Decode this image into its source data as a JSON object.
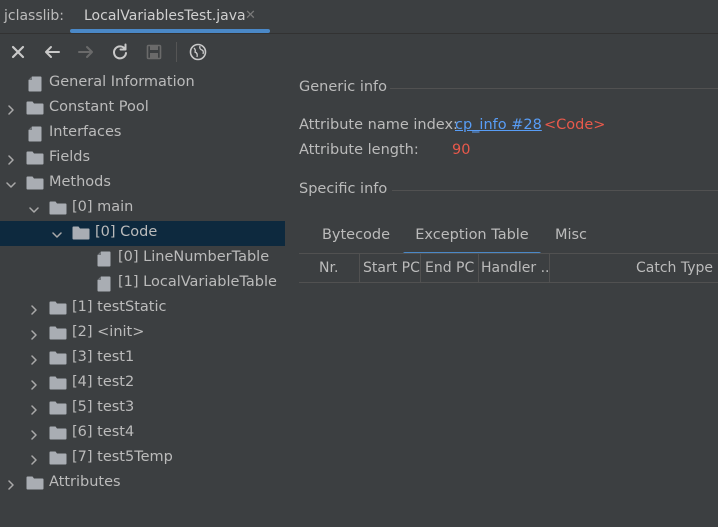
{
  "title_bar": {
    "app_label": "jclasslib:",
    "tab_label": "LocalVariablesTest.java",
    "tab_close": "✕"
  },
  "toolbar": {
    "buttons": [
      "close-icon",
      "back-icon",
      "forward-icon",
      "refresh-icon",
      "save-icon",
      "browser-icon"
    ]
  },
  "tree": {
    "items": [
      {
        "label": "General Information",
        "type": "file",
        "expand": "none"
      },
      {
        "label": "Constant Pool",
        "type": "folder",
        "expand": "collapsed"
      },
      {
        "label": "Interfaces",
        "type": "file",
        "expand": "none"
      },
      {
        "label": "Fields",
        "type": "folder",
        "expand": "collapsed"
      },
      {
        "label": "Methods",
        "type": "folder",
        "expand": "expanded"
      },
      {
        "label": "[0] main",
        "type": "folder",
        "expand": "expanded"
      },
      {
        "label": "[0] Code",
        "type": "folder",
        "expand": "expanded",
        "selected": true
      },
      {
        "label": "[0] LineNumberTable",
        "type": "file",
        "expand": "none"
      },
      {
        "label": "[1] LocalVariableTable",
        "type": "file",
        "expand": "none"
      },
      {
        "label": "[1] testStatic",
        "type": "folder",
        "expand": "collapsed"
      },
      {
        "label": "[2] <init>",
        "type": "folder",
        "expand": "collapsed"
      },
      {
        "label": "[3] test1",
        "type": "folder",
        "expand": "collapsed"
      },
      {
        "label": "[4] test2",
        "type": "folder",
        "expand": "collapsed"
      },
      {
        "label": "[5] test3",
        "type": "folder",
        "expand": "collapsed"
      },
      {
        "label": "[6] test4",
        "type": "folder",
        "expand": "collapsed"
      },
      {
        "label": "[7] test5Temp",
        "type": "folder",
        "expand": "collapsed"
      },
      {
        "label": "Attributes",
        "type": "folder",
        "expand": "collapsed"
      }
    ]
  },
  "generic_info": {
    "title": "Generic info",
    "name_index_label": "Attribute name index:",
    "name_index_link": "cp_info #28",
    "name_index_value": "<Code>",
    "length_label": "Attribute length:",
    "length_value": "90"
  },
  "specific_info": {
    "title": "Specific info",
    "tabs": [
      "Bytecode",
      "Exception Table",
      "Misc"
    ],
    "active_tab": "Exception Table",
    "columns": [
      "Nr.",
      "Start PC",
      "End PC",
      "Handler ...",
      "Catch Type"
    ]
  },
  "colors": {
    "background": "#3c3f41",
    "selection": "#0d293e",
    "accent": "#4a88c7",
    "link": "#589df6",
    "value_red": "#e8594b"
  }
}
